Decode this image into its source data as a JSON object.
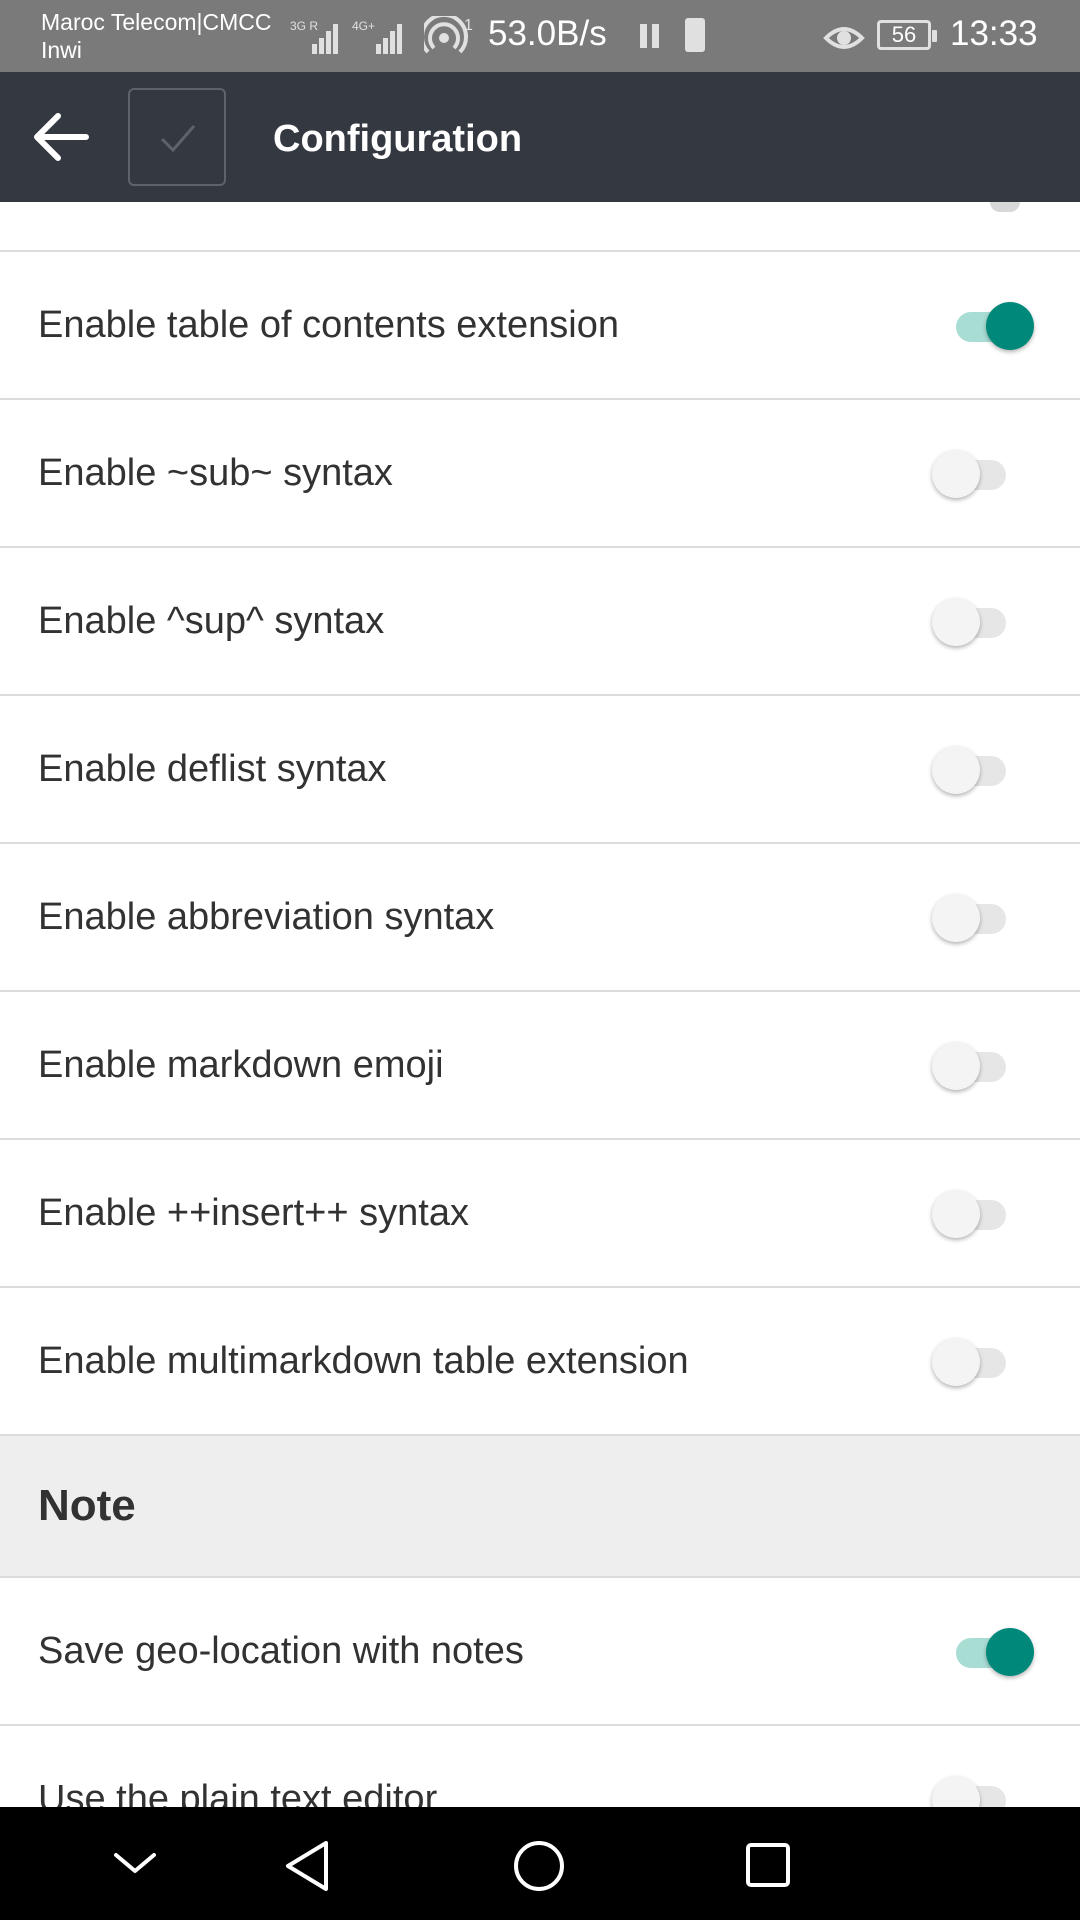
{
  "status_bar": {
    "carrier_1": "Maroc Telecom|CMCC",
    "carrier_2": "Inwi",
    "signal_1_label": "3G R",
    "signal_2_label": "4G+",
    "hotspot_count": "1",
    "net_speed": "53.0B/s",
    "battery_level": "56",
    "time": "13:33"
  },
  "toolbar": {
    "title": "Configuration",
    "back_icon": "arrow-back-icon",
    "check_icon": "check-icon"
  },
  "settings": [
    {
      "label": "Enable table of contents extension",
      "enabled": true
    },
    {
      "label": "Enable ~sub~ syntax",
      "enabled": false
    },
    {
      "label": "Enable ^sup^ syntax",
      "enabled": false
    },
    {
      "label": "Enable deflist syntax",
      "enabled": false
    },
    {
      "label": "Enable abbreviation syntax",
      "enabled": false
    },
    {
      "label": "Enable markdown emoji",
      "enabled": false
    },
    {
      "label": "Enable ++insert++ syntax",
      "enabled": false
    },
    {
      "label": "Enable multimarkdown table extension",
      "enabled": false
    }
  ],
  "note_section": {
    "header": "Note",
    "settings": [
      {
        "label": "Save geo-location with notes",
        "enabled": true
      },
      {
        "label": "Use the plain text editor",
        "enabled": false
      }
    ]
  },
  "colors": {
    "toolbar_bg": "#343840",
    "switch_on": "#00897b",
    "switch_on_track": "#a8ddd4",
    "status_bar_bg": "#7a7a7a"
  },
  "nav_bar": {
    "icons": [
      "chevron-down-icon",
      "back-triangle-icon",
      "home-circle-icon",
      "recents-square-icon"
    ]
  }
}
